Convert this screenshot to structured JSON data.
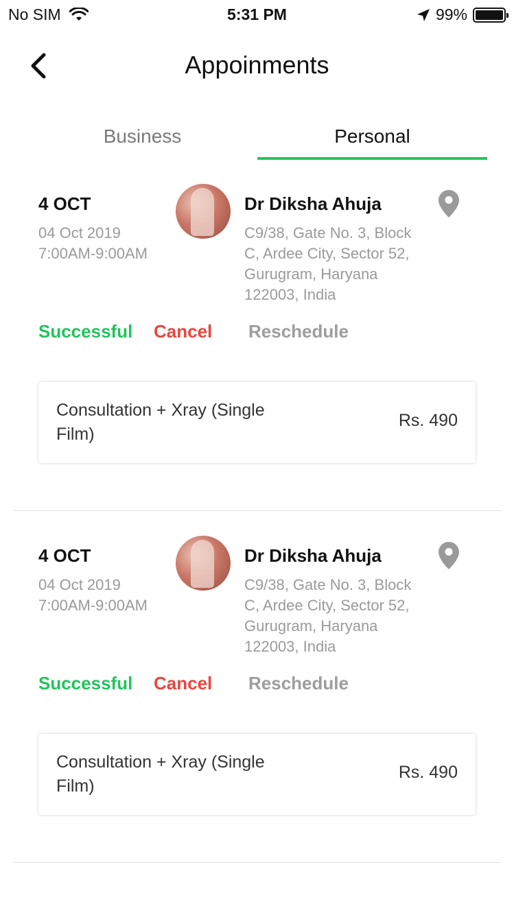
{
  "status_bar": {
    "carrier": "No SIM",
    "time": "5:31 PM",
    "battery": "99%",
    "battery_level": 0.99
  },
  "header": {
    "title": "Appoinments"
  },
  "tabs": [
    {
      "label": "Business",
      "active": false
    },
    {
      "label": "Personal",
      "active": true
    }
  ],
  "appointments": [
    {
      "date_short": "4 OCT",
      "date_long": "04 Oct 2019",
      "time": "7:00AM-9:00AM",
      "doctor": "Dr Diksha Ahuja",
      "address": "C9/38, Gate No. 3, Block C, Ardee City, Sector 52, Gurugram, Haryana 122003, India",
      "status": "Successful",
      "cancel_label": "Cancel",
      "reschedule_label": "Reschedule",
      "service": "Consultation + Xray (Single Film)",
      "price": "Rs. 490"
    },
    {
      "date_short": "4 OCT",
      "date_long": "04 Oct 2019",
      "time": "7:00AM-9:00AM",
      "doctor": "Dr Diksha Ahuja",
      "address": "C9/38, Gate No. 3, Block C, Ardee City, Sector 52, Gurugram, Haryana 122003, India",
      "status": "Successful",
      "cancel_label": "Cancel",
      "reschedule_label": "Reschedule",
      "service": "Consultation + Xray (Single Film)",
      "price": "Rs. 490"
    }
  ],
  "colors": {
    "accent": "#27c35a",
    "success": "#22c35c",
    "cancel": "#e8473f",
    "muted": "#9a9a9a"
  },
  "icons": {
    "back": "chevron-left-icon",
    "wifi": "wifi-icon",
    "location": "location-arrow-icon",
    "pin": "map-pin-icon"
  }
}
